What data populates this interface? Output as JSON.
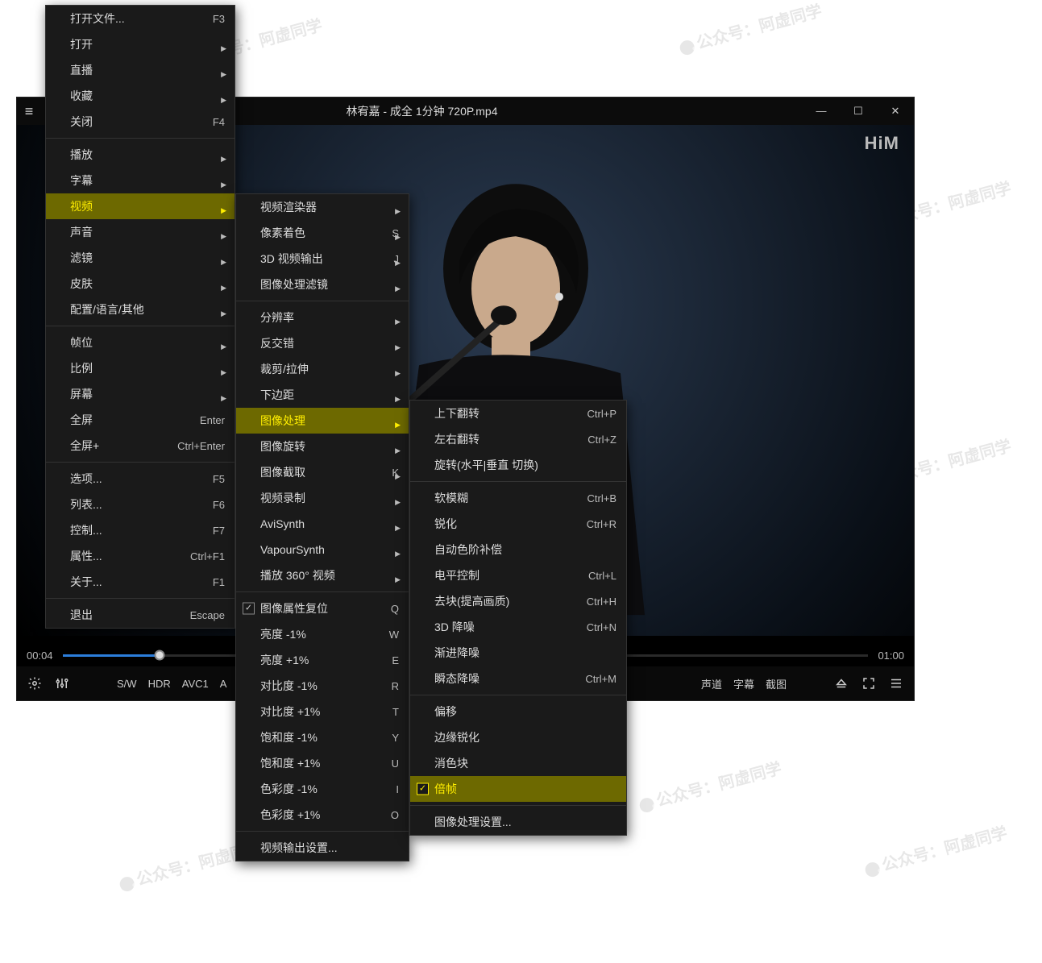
{
  "window": {
    "title": "林宥嘉 - 成全 1分钟 720P.mp4",
    "minimize": "—",
    "maximize": "☐",
    "close": "✕",
    "logo": "HiM"
  },
  "seek": {
    "current": "00:04",
    "total": "01:00"
  },
  "controls": {
    "sw": "S/W",
    "hdr": "HDR",
    "codec1": "AVC1",
    "codec2": "A",
    "audio_ch": "声道",
    "subtitle": "字幕",
    "screenshot": "截图"
  },
  "menu1": [
    {
      "t": 0,
      "label": "打开文件...",
      "shortcut": "F3"
    },
    {
      "t": 0,
      "label": "打开",
      "arrow": true
    },
    {
      "t": 0,
      "label": "直播",
      "arrow": true
    },
    {
      "t": 0,
      "label": "收藏",
      "arrow": true
    },
    {
      "t": 0,
      "label": "关闭",
      "shortcut": "F4"
    },
    {
      "t": 1
    },
    {
      "t": 0,
      "label": "播放",
      "arrow": true
    },
    {
      "t": 0,
      "label": "字幕",
      "arrow": true
    },
    {
      "t": 0,
      "label": "视频",
      "arrow": true,
      "hi": true
    },
    {
      "t": 0,
      "label": "声音",
      "arrow": true
    },
    {
      "t": 0,
      "label": "滤镜",
      "arrow": true
    },
    {
      "t": 0,
      "label": "皮肤",
      "arrow": true
    },
    {
      "t": 0,
      "label": "配置/语言/其他",
      "arrow": true
    },
    {
      "t": 1
    },
    {
      "t": 0,
      "label": "帧位",
      "arrow": true
    },
    {
      "t": 0,
      "label": "比例",
      "arrow": true
    },
    {
      "t": 0,
      "label": "屏幕",
      "arrow": true
    },
    {
      "t": 0,
      "label": "全屏",
      "shortcut": "Enter"
    },
    {
      "t": 0,
      "label": "全屏+",
      "shortcut": "Ctrl+Enter"
    },
    {
      "t": 1
    },
    {
      "t": 0,
      "label": "选项...",
      "shortcut": "F5"
    },
    {
      "t": 0,
      "label": "列表...",
      "shortcut": "F6"
    },
    {
      "t": 0,
      "label": "控制...",
      "shortcut": "F7"
    },
    {
      "t": 0,
      "label": "属性...",
      "shortcut": "Ctrl+F1"
    },
    {
      "t": 0,
      "label": "关于...",
      "shortcut": "F1"
    },
    {
      "t": 1
    },
    {
      "t": 0,
      "label": "退出",
      "shortcut": "Escape"
    }
  ],
  "menu2": [
    {
      "t": 0,
      "label": "视频渲染器",
      "arrow": true
    },
    {
      "t": 0,
      "label": "像素着色",
      "shortcut": "S",
      "arrow": true
    },
    {
      "t": 0,
      "label": "3D 视频输出",
      "shortcut": "J",
      "arrow": true
    },
    {
      "t": 0,
      "label": "图像处理滤镜",
      "arrow": true
    },
    {
      "t": 1
    },
    {
      "t": 0,
      "label": "分辨率",
      "arrow": true
    },
    {
      "t": 0,
      "label": "反交错",
      "arrow": true
    },
    {
      "t": 0,
      "label": "裁剪/拉伸",
      "arrow": true
    },
    {
      "t": 0,
      "label": "下边距",
      "arrow": true
    },
    {
      "t": 0,
      "label": "图像处理",
      "arrow": true,
      "hi": true
    },
    {
      "t": 0,
      "label": "图像旋转",
      "arrow": true
    },
    {
      "t": 0,
      "label": "图像截取",
      "shortcut": "K",
      "arrow": true
    },
    {
      "t": 0,
      "label": "视频录制",
      "arrow": true
    },
    {
      "t": 0,
      "label": "AviSynth",
      "arrow": true
    },
    {
      "t": 0,
      "label": "VapourSynth",
      "arrow": true
    },
    {
      "t": 0,
      "label": "播放 360° 视频",
      "arrow": true
    },
    {
      "t": 1
    },
    {
      "t": 0,
      "label": "图像属性复位",
      "shortcut": "Q",
      "box": true,
      "on": true,
      "plain": true
    },
    {
      "t": 0,
      "label": "亮度 -1%",
      "shortcut": "W"
    },
    {
      "t": 0,
      "label": "亮度 +1%",
      "shortcut": "E"
    },
    {
      "t": 0,
      "label": "对比度 -1%",
      "shortcut": "R"
    },
    {
      "t": 0,
      "label": "对比度 +1%",
      "shortcut": "T"
    },
    {
      "t": 0,
      "label": "饱和度 -1%",
      "shortcut": "Y"
    },
    {
      "t": 0,
      "label": "饱和度 +1%",
      "shortcut": "U"
    },
    {
      "t": 0,
      "label": "色彩度 -1%",
      "shortcut": "I"
    },
    {
      "t": 0,
      "label": "色彩度 +1%",
      "shortcut": "O"
    },
    {
      "t": 1
    },
    {
      "t": 0,
      "label": "视频输出设置..."
    }
  ],
  "menu3": [
    {
      "t": 0,
      "label": "上下翻转",
      "shortcut": "Ctrl+P"
    },
    {
      "t": 0,
      "label": "左右翻转",
      "shortcut": "Ctrl+Z"
    },
    {
      "t": 0,
      "label": "旋转(水平|垂直 切换)"
    },
    {
      "t": 1
    },
    {
      "t": 0,
      "label": "软模糊",
      "shortcut": "Ctrl+B"
    },
    {
      "t": 0,
      "label": "锐化",
      "shortcut": "Ctrl+R"
    },
    {
      "t": 0,
      "label": "自动色阶补偿"
    },
    {
      "t": 0,
      "label": "电平控制",
      "shortcut": "Ctrl+L"
    },
    {
      "t": 0,
      "label": "去块(提高画质)",
      "shortcut": "Ctrl+H"
    },
    {
      "t": 0,
      "label": "3D 降噪",
      "shortcut": "Ctrl+N"
    },
    {
      "t": 0,
      "label": "渐进降噪"
    },
    {
      "t": 0,
      "label": "瞬态降噪",
      "shortcut": "Ctrl+M"
    },
    {
      "t": 1
    },
    {
      "t": 0,
      "label": "偏移"
    },
    {
      "t": 0,
      "label": "边缘锐化"
    },
    {
      "t": 0,
      "label": "消色块"
    },
    {
      "t": 0,
      "label": "倍帧",
      "box": true,
      "on": true,
      "hi": true
    },
    {
      "t": 1
    },
    {
      "t": 0,
      "label": "图像处理设置..."
    }
  ],
  "watermark": "公众号：阿虚同学"
}
